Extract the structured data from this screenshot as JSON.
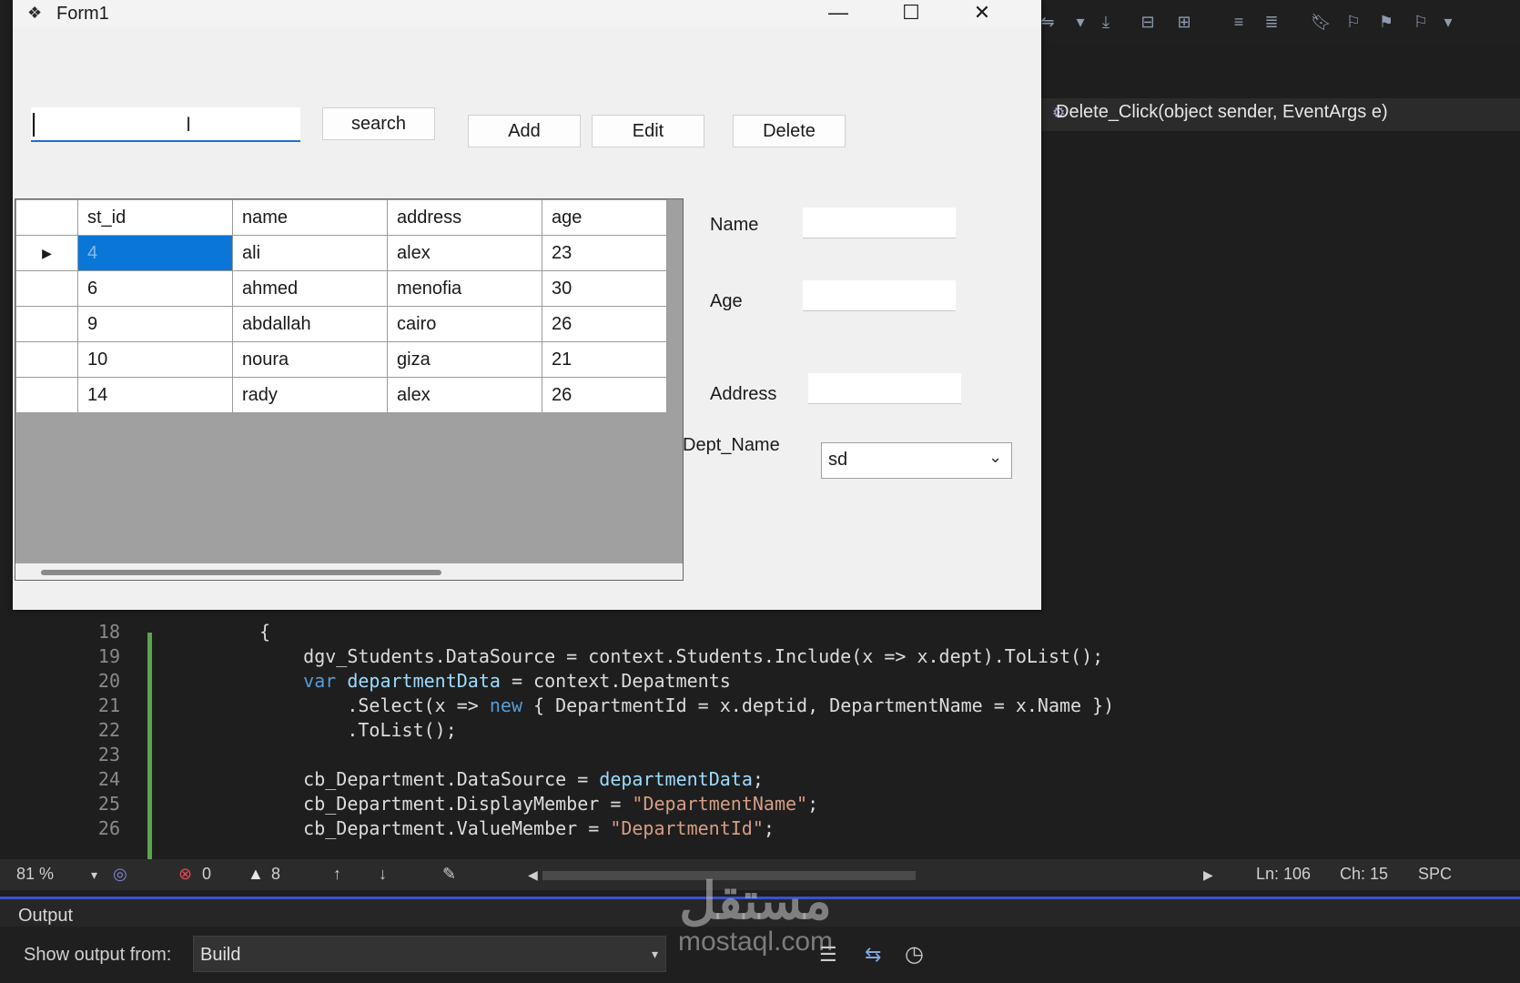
{
  "form": {
    "title": "Form1",
    "window_controls": {
      "minimize": "—",
      "maximize": "☐",
      "close": "✕"
    },
    "search": {
      "value": "",
      "button_label": "search"
    },
    "buttons": {
      "add": "Add",
      "edit": "Edit",
      "delete": "Delete"
    },
    "grid": {
      "columns": [
        "st_id",
        "name",
        "address",
        "age"
      ],
      "rows": [
        {
          "st_id": "4",
          "name": "ali",
          "address": "alex",
          "age": "23"
        },
        {
          "st_id": "6",
          "name": "ahmed",
          "address": "menofia",
          "age": "30"
        },
        {
          "st_id": "9",
          "name": "abdallah",
          "address": "cairo",
          "age": "26"
        },
        {
          "st_id": "10",
          "name": "noura",
          "address": "giza",
          "age": "21"
        },
        {
          "st_id": "14",
          "name": "rady",
          "address": "alex",
          "age": "26"
        }
      ],
      "selected_row_marker": "▶"
    },
    "fields": {
      "name_label": "Name",
      "name_value": "",
      "age_label": "Age",
      "age_value": "",
      "address_label": "Address",
      "address_value": "",
      "dept_label": "Dept_Name",
      "dept_value": "sd"
    }
  },
  "ide": {
    "navigation_method": "Delete_Click(object sender, EventArgs e)",
    "code_lines": [
      {
        "num": "18",
        "text": "{"
      },
      {
        "num": "19",
        "text": "    dgv_Students.DataSource = context.Students.Include(x => x.dept).ToList();"
      },
      {
        "num": "20",
        "text": "    var departmentData = context.Depatments"
      },
      {
        "num": "21",
        "text": "        .Select(x => new { DepartmentId = x.deptid, DepartmentName = x.Name })"
      },
      {
        "num": "22",
        "text": "        .ToList();"
      },
      {
        "num": "23",
        "text": ""
      },
      {
        "num": "24",
        "text": "    cb_Department.DataSource = departmentData;"
      },
      {
        "num": "25",
        "text": "    cb_Department.DisplayMember = \"DepartmentName\";"
      },
      {
        "num": "26",
        "text": "    cb_Department.ValueMember = \"DepartmentId\";"
      }
    ],
    "status": {
      "zoom": "81 %",
      "errors": "0",
      "warnings": "8",
      "line": "Ln: 106",
      "col": "Ch: 15",
      "spacing": "SPC"
    },
    "output": {
      "title": "Output",
      "show_from_label": "Show output from:",
      "source": "Build"
    }
  },
  "watermark": {
    "arabic": "مستقل",
    "latin": "mostaql.com"
  }
}
